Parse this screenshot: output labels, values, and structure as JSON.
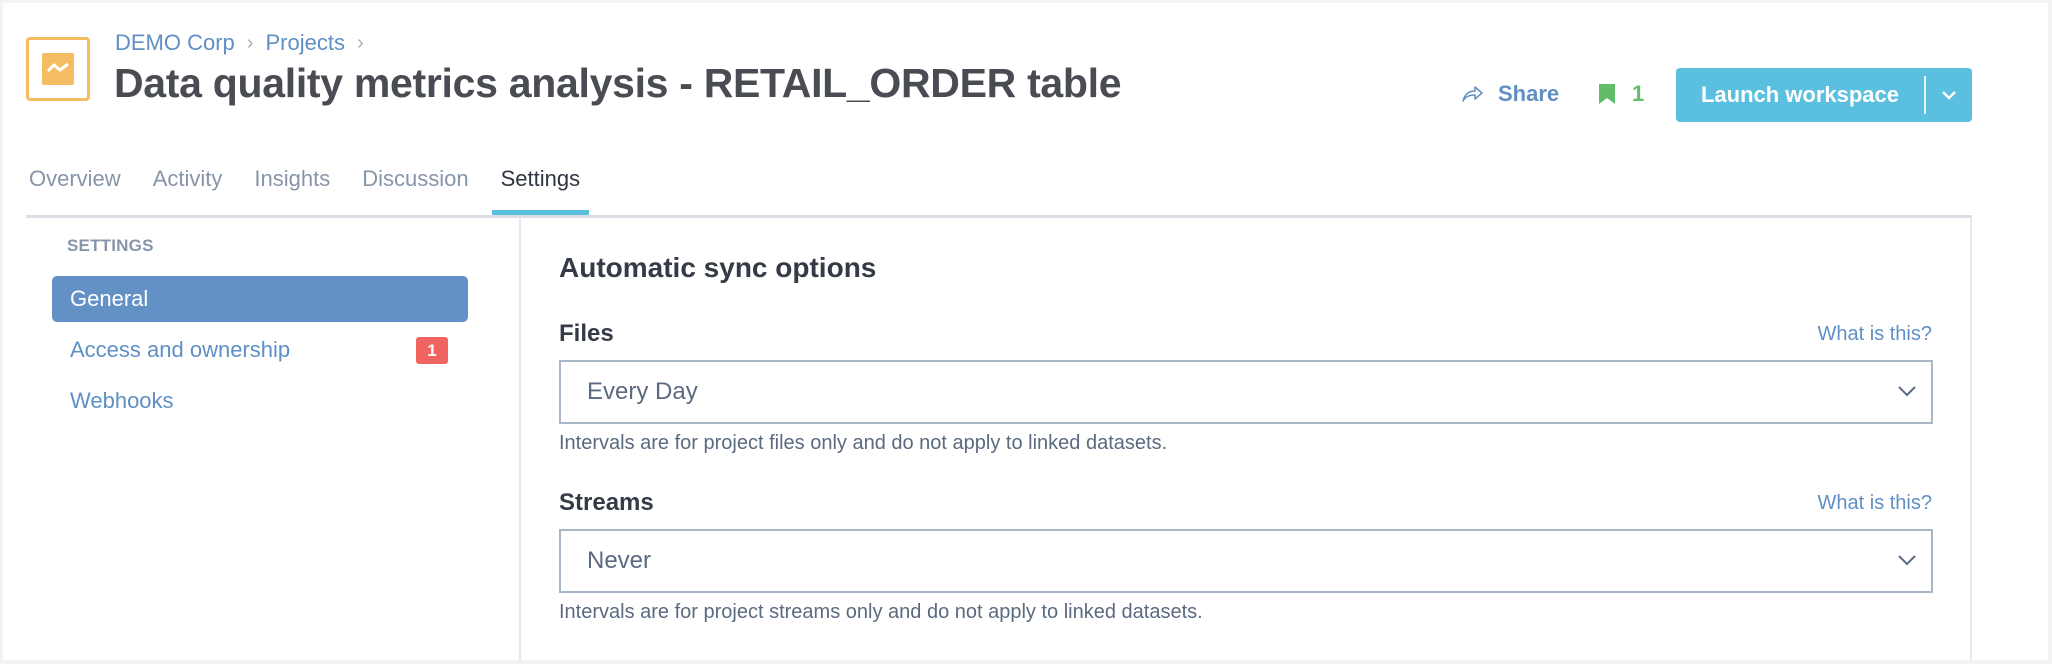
{
  "header": {
    "breadcrumb": [
      "DEMO Corp",
      "Projects"
    ],
    "title": "Data quality metrics analysis - RETAIL_ORDER table",
    "share_label": "Share",
    "bookmark_count": "1",
    "launch_label": "Launch workspace"
  },
  "tabs": [
    {
      "label": "Overview",
      "active": false
    },
    {
      "label": "Activity",
      "active": false
    },
    {
      "label": "Insights",
      "active": false
    },
    {
      "label": "Discussion",
      "active": false
    },
    {
      "label": "Settings",
      "active": true
    }
  ],
  "sidebar": {
    "heading": "SETTINGS",
    "items": [
      {
        "label": "General",
        "active": true
      },
      {
        "label": "Access and ownership",
        "badge": "1"
      },
      {
        "label": "Webhooks"
      }
    ]
  },
  "content": {
    "section_title": "Automatic sync options",
    "files": {
      "label": "Files",
      "help_link": "What is this?",
      "selected": "Every Day",
      "help_text": "Intervals are for project files only and do not apply to linked datasets."
    },
    "streams": {
      "label": "Streams",
      "help_link": "What is this?",
      "selected": "Never",
      "help_text": "Intervals are for project streams only and do not apply to linked datasets."
    }
  },
  "colors": {
    "accent": "#5bbfdf",
    "link": "#5f8fc4",
    "logo": "#f5bd63",
    "bookmark": "#62bd6a",
    "badge": "#ef6461",
    "sidebar_active": "#6391c5"
  }
}
